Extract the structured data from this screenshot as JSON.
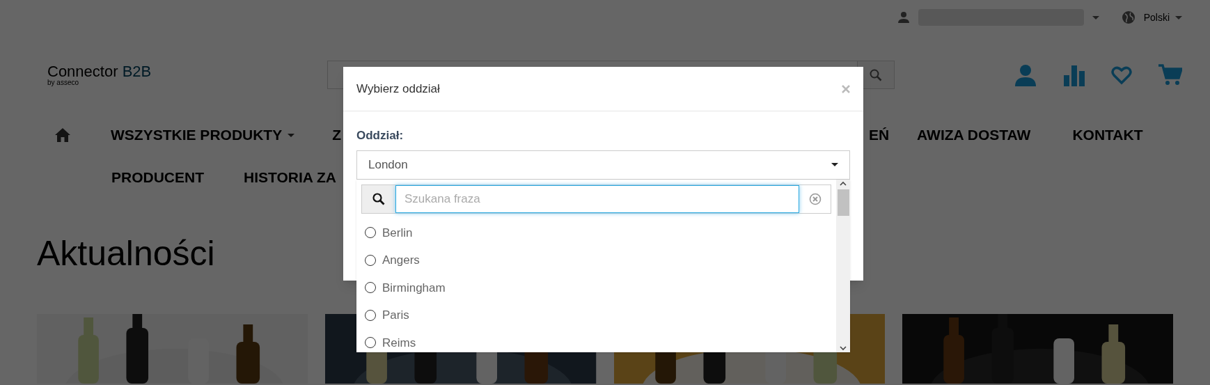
{
  "top_bar": {
    "language": "Polski"
  },
  "header": {
    "logo": {
      "name": "Connector",
      "suffix": "B2B",
      "byline": "by asseco"
    }
  },
  "nav": {
    "rows": [
      [
        {
          "kind": "home"
        },
        {
          "kind": "link",
          "label": "WSZYSTKIE PRODUKTY",
          "has_caret": true
        },
        {
          "kind": "link",
          "label": "Z",
          "has_caret": false
        },
        {
          "kind": "link",
          "label": "EŃ",
          "has_caret": false
        },
        {
          "kind": "link",
          "label": "AWIZA DOSTAW",
          "has_caret": false
        },
        {
          "kind": "link",
          "label": "KONTAKT",
          "has_caret": false
        }
      ],
      [
        {
          "kind": "link",
          "label": "PRODUCENT",
          "has_caret": false
        },
        {
          "kind": "link",
          "label": "HISTORIA ZA",
          "has_caret": false
        }
      ]
    ]
  },
  "news": {
    "title": "Aktualności"
  },
  "modal": {
    "title": "Wybierz oddział",
    "field_label": "Oddział:",
    "select": {
      "value": "London",
      "search": {
        "placeholder": "Szukana fraza"
      },
      "options": [
        {
          "label": "Berlin",
          "selected": false
        },
        {
          "label": "Angers",
          "selected": false
        },
        {
          "label": "Birmingham",
          "selected": false
        },
        {
          "label": "Paris",
          "selected": false
        },
        {
          "label": "Reims",
          "selected": false
        }
      ]
    }
  }
}
